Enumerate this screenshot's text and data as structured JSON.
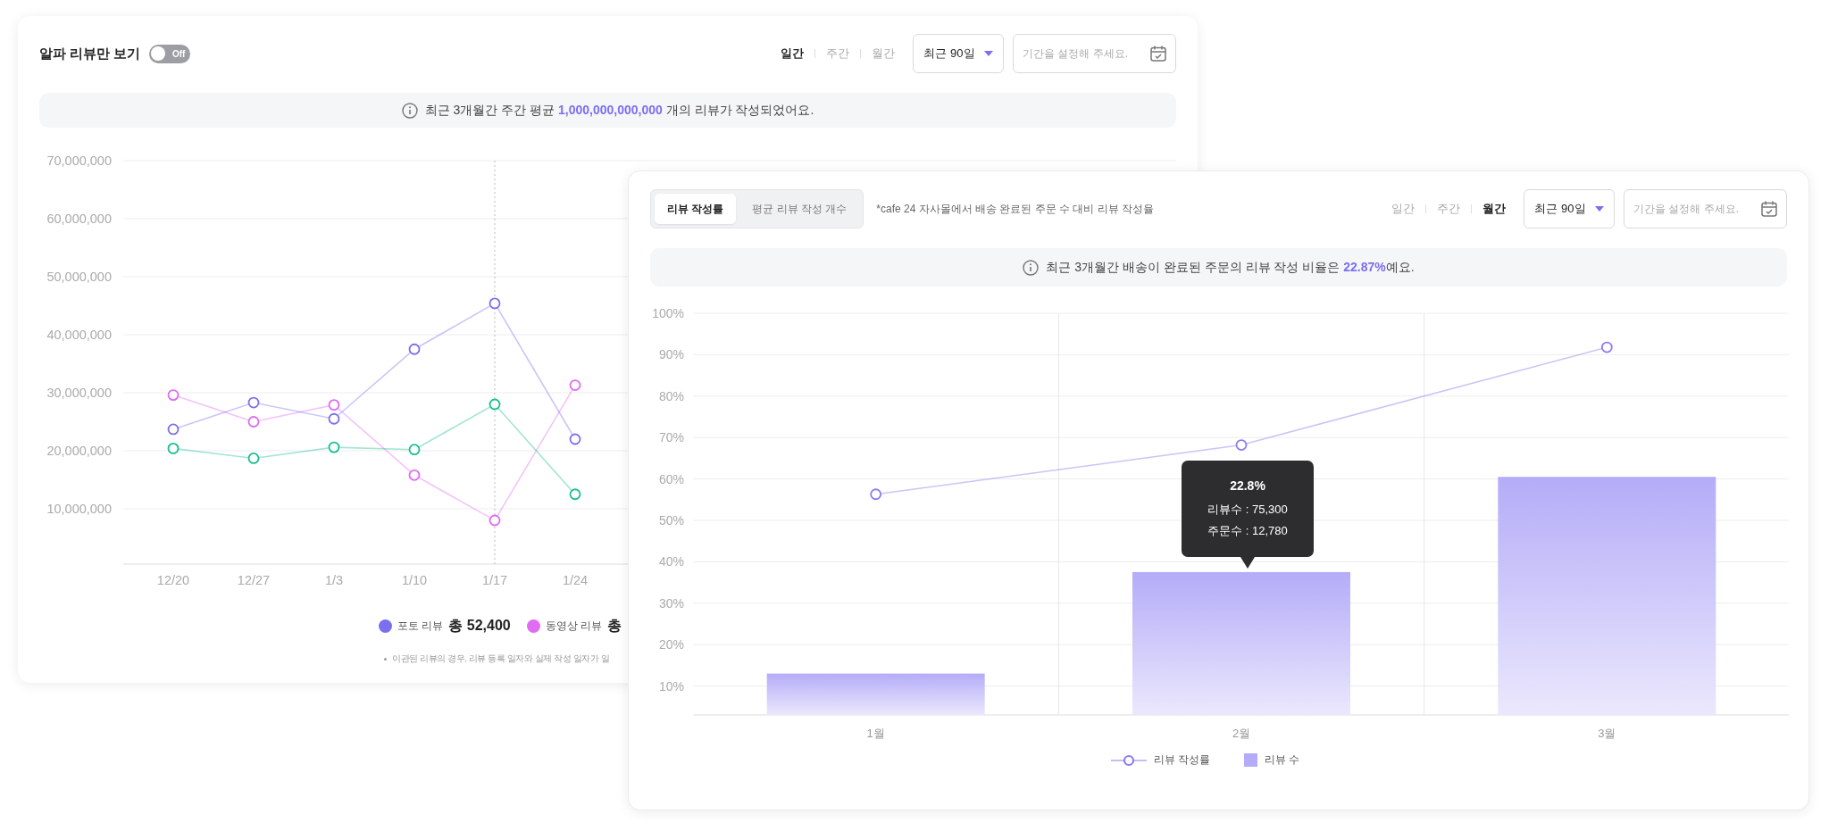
{
  "review_count_card": {
    "alpha_filter": {
      "label": "알파 리뷰만 보기",
      "on": false,
      "state_label": "Off"
    },
    "periods": [
      {
        "label": "일간",
        "selected": true
      },
      {
        "label": "주간",
        "selected": false
      },
      {
        "label": "월간",
        "selected": false
      }
    ],
    "range_dropdown": {
      "value": "최근 90일"
    },
    "date_field": {
      "placeholder": "기간을 설정해 주세요."
    },
    "info": "최근 3개월간 주간 평균 **1,000,000,000,000** 개의 리뷰가 작성되었어요.",
    "chart_data": {
      "type": "line",
      "categories": [
        "12/20",
        "12/27",
        "1/3",
        "1/10",
        "1/17",
        "1/24"
      ],
      "ylim": [
        0,
        70000000
      ],
      "yticks": [
        {
          "value": 10000000,
          "label": "10,000,000"
        },
        {
          "value": 20000000,
          "label": "20,000,000"
        },
        {
          "value": 30000000,
          "label": "30,000,000"
        },
        {
          "value": 40000000,
          "label": "40,000,000"
        },
        {
          "value": 50000000,
          "label": "50,000,000"
        },
        {
          "value": 60000000,
          "label": "60,000,000"
        },
        {
          "value": 70000000,
          "label": "70,000,000"
        }
      ],
      "grid": true,
      "series": [
        {
          "color": "#7b6ff0",
          "marker": "circle",
          "values": [
            23700000,
            28300000,
            25500000,
            37500000,
            45400000,
            22000000
          ]
        },
        {
          "color": "#df6cf3",
          "marker": "circle",
          "values": [
            29600000,
            25000000,
            27900000,
            15800000,
            8000000,
            31300000
          ]
        },
        {
          "color": "#16bf8c",
          "marker": "circle",
          "values": [
            20400000,
            18700000,
            20600000,
            20200000,
            28000000,
            12500000
          ]
        }
      ],
      "ref_lines": [
        {
          "axis": "x",
          "value": "1/17"
        }
      ]
    },
    "legend": [
      {
        "label": "포토 리뷰",
        "total": "총 52,400",
        "color": "#7b6ff0"
      },
      {
        "label": "동영상 리뷰",
        "total": "총",
        "color": "#df6cf3"
      }
    ],
    "footnote": "이관된 리뷰의 경우, 리뷰 등록 일자와 실제 작성 일자가 일"
  },
  "review_rate_card": {
    "tabs": [
      {
        "label": "리뷰 작성률",
        "selected": true
      },
      {
        "label": "평균 리뷰 작성 개수",
        "selected": false
      }
    ],
    "note": "*cafe 24 자사몰에서 배송 완료된 주문 수 대비 리뷰 작성율",
    "periods": [
      {
        "label": "일간",
        "selected": false
      },
      {
        "label": "주간",
        "selected": false
      },
      {
        "label": "월간",
        "selected": true
      }
    ],
    "range_dropdown": {
      "value": "최근 90일"
    },
    "date_field": {
      "placeholder": "기간을 설정해 주세요."
    },
    "info": "최근 3개월간 배송이 완료된 주문의 리뷰 작성 비율은 **22.87%**예요.",
    "chart_data": {
      "type": "bar",
      "categories": [
        "1월",
        "2월",
        "3월"
      ],
      "ylim": [
        3,
        100
      ],
      "yticks": [
        {
          "value": 10,
          "label": "10%"
        },
        {
          "value": 20,
          "label": "20%"
        },
        {
          "value": 30,
          "label": "30%"
        },
        {
          "value": 40,
          "label": "40%"
        },
        {
          "value": 50,
          "label": "50%"
        },
        {
          "value": 60,
          "label": "60%"
        },
        {
          "value": 70,
          "label": "70%"
        },
        {
          "value": 80,
          "label": "80%"
        },
        {
          "value": 90,
          "label": "90%"
        },
        {
          "value": 100,
          "label": "100%"
        }
      ],
      "grid": true,
      "series": [
        {
          "name": "리뷰 작성률",
          "type": "line",
          "marker": "circle",
          "color": "#8b7cf0",
          "values": [
            56.3,
            68.2,
            91.8
          ]
        },
        {
          "name": "리뷰 수",
          "type": "bar",
          "color": "#b4acf8",
          "values": [
            13,
            37.5,
            60.5
          ]
        }
      ]
    },
    "tooltip": {
      "title": "22.8%",
      "lines": [
        "리뷰수 : 75,300",
        "주문수 : 12,780"
      ]
    }
  }
}
